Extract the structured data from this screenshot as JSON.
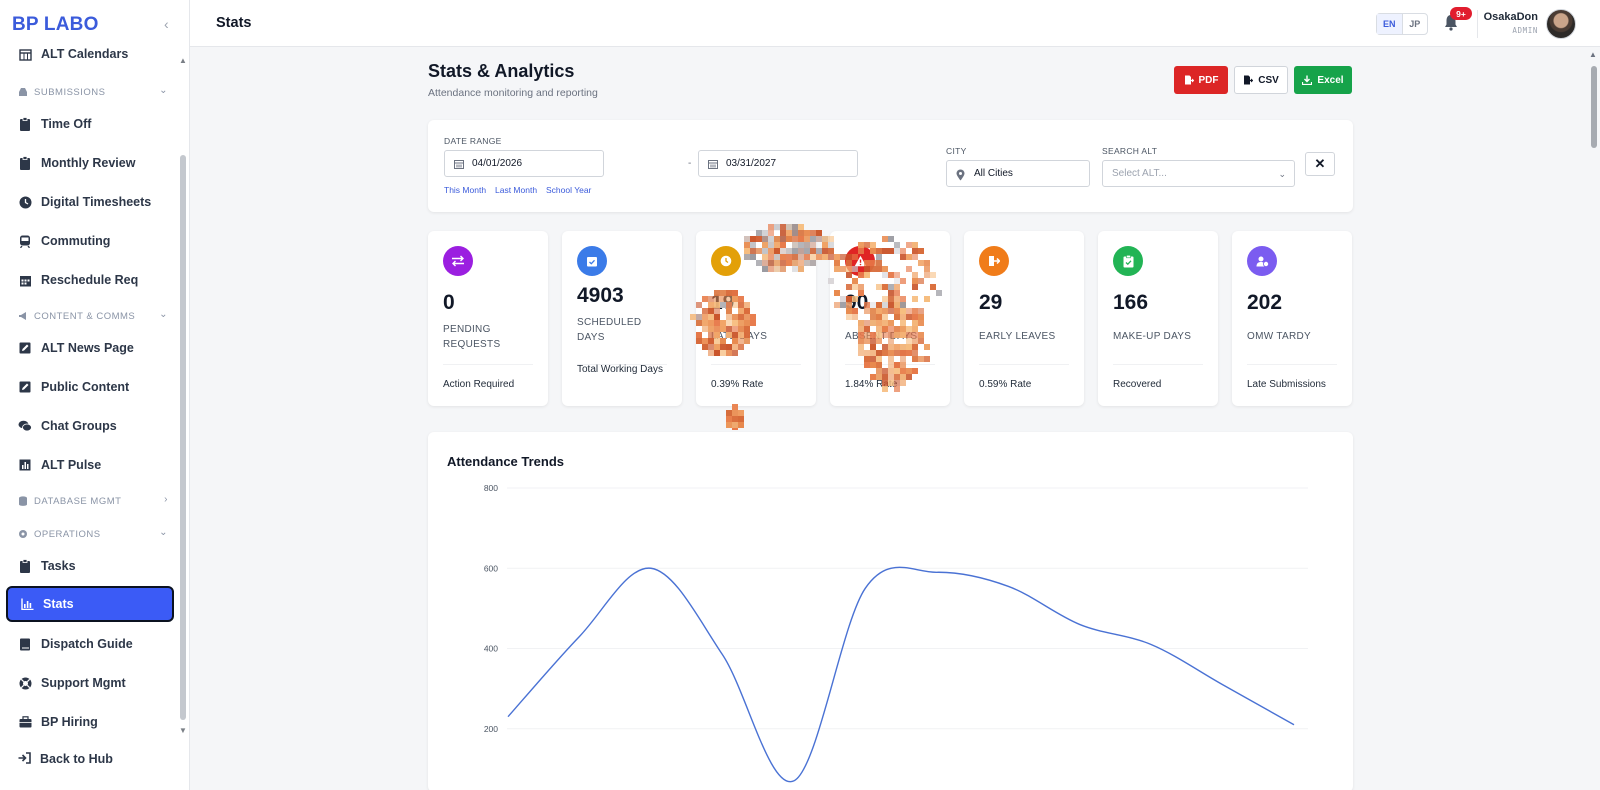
{
  "brand": "BP LABO",
  "sidebar": {
    "items": [
      {
        "label": "ALT Calendars",
        "icon": "calendar-grid-icon"
      },
      {
        "label": "Time Off",
        "icon": "clipboard-icon"
      },
      {
        "label": "Monthly Review",
        "icon": "clipboard-icon"
      },
      {
        "label": "Digital Timesheets",
        "icon": "clock-icon"
      },
      {
        "label": "Commuting",
        "icon": "train-icon"
      },
      {
        "label": "Reschedule Req",
        "icon": "calendar-icon"
      },
      {
        "label": "ALT News Page",
        "icon": "pencil-icon"
      },
      {
        "label": "Public Content",
        "icon": "pencil-icon"
      },
      {
        "label": "Chat Groups",
        "icon": "chat-icon"
      },
      {
        "label": "ALT Pulse",
        "icon": "chart-icon"
      },
      {
        "label": "Tasks",
        "icon": "clipboard-icon"
      },
      {
        "label": "Stats",
        "icon": "chart-icon"
      },
      {
        "label": "Dispatch Guide",
        "icon": "book-icon"
      },
      {
        "label": "Support Mgmt",
        "icon": "lifebuoy-icon"
      },
      {
        "label": "BP Hiring",
        "icon": "briefcase-icon"
      }
    ],
    "sections": {
      "submissions": "SUBMISSIONS",
      "content": "CONTENT & COMMS",
      "database": "DATABASE MGMT",
      "operations": "OPERATIONS"
    },
    "back_to_hub": "Back to Hub"
  },
  "topbar": {
    "title": "Stats",
    "lang_en": "EN",
    "lang_jp": "JP",
    "notifications_badge": "9+",
    "user_name": "OsakaDon",
    "user_role": "ADMIN"
  },
  "header": {
    "title": "Stats & Analytics",
    "subtitle": "Attendance monitoring and reporting",
    "pdf_label": "PDF",
    "csv_label": "CSV",
    "excel_label": "Excel"
  },
  "filters": {
    "date_range_label": "DATE RANGE",
    "date_from": "04/01/2026",
    "date_to": "03/31/2027",
    "date_separator": "-",
    "quick_this_month": "This Month",
    "quick_last_month": "Last Month",
    "quick_school_year": "School Year",
    "city_label": "CITY",
    "city_value": "All Cities",
    "search_alt_label": "SEARCH ALT",
    "search_alt_placeholder": "Select ALT...",
    "clear_label": "✕"
  },
  "stats": [
    {
      "value": "0",
      "label": "PENDING REQUESTS",
      "footer": "Action Required",
      "color": "#9b1fe0",
      "icon": "swap-icon"
    },
    {
      "value": "4903",
      "label": "SCHEDULED DAYS",
      "footer": "Total Working Days",
      "color": "#3b7be8",
      "icon": "calendar-check-icon"
    },
    {
      "value": "19",
      "label": "LATE DAYS",
      "footer": "0.39% Rate",
      "color": "#e3a008",
      "icon": "clock-icon"
    },
    {
      "value": "90",
      "label": "ABSENT DAYS",
      "footer": "1.84% Rate",
      "color": "#e02424",
      "icon": "warning-icon"
    },
    {
      "value": "29",
      "label": "EARLY LEAVES",
      "footer": "0.59% Rate",
      "color": "#f07c1a",
      "icon": "exit-icon"
    },
    {
      "value": "166",
      "label": "MAKE-UP DAYS",
      "footer": "Recovered",
      "color": "#22b455",
      "icon": "clipboard-check-icon"
    },
    {
      "value": "202",
      "label": "OMW TARDY",
      "footer": "Late Submissions",
      "color": "#7b5cf0",
      "icon": "user-clock-icon"
    }
  ],
  "chart_data": {
    "type": "line",
    "title": "Attendance Trends",
    "ylim": [
      0,
      800
    ],
    "yticks": [
      200,
      400,
      600,
      800
    ],
    "grid": true,
    "series": [
      {
        "color": "#4a72d4",
        "values": [
          230,
          430,
          600,
          385,
          70,
          550,
          590,
          555,
          460,
          410,
          310,
          210
        ]
      }
    ]
  }
}
